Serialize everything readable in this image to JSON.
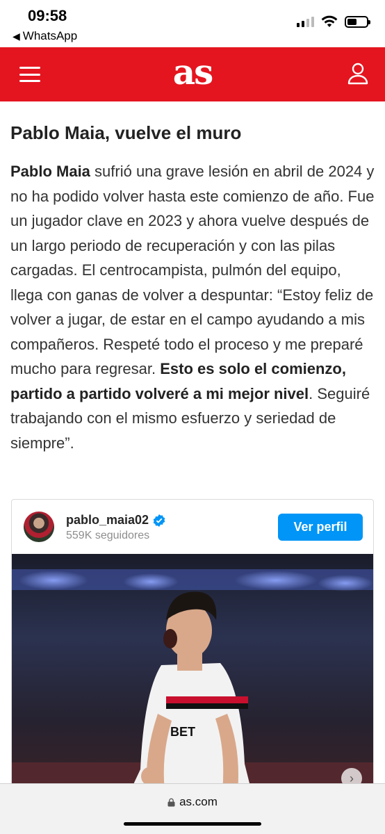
{
  "status_bar": {
    "time": "09:58",
    "back_app": "WhatsApp"
  },
  "header": {
    "logo": "as",
    "brand_color": "#e4151f"
  },
  "article": {
    "title": "Pablo Maia, vuelve el muro",
    "body": {
      "s1_bold": "Pablo Maia",
      "s2": " sufrió una grave lesión en abril de 2024 y no ha podido volver hasta este comienzo de año. Fue un jugador clave en 2023 y ahora vuelve después de un largo periodo de recuperación y con las pilas cargadas. El centrocampista, pulmón del equipo, llega con ganas de volver a despuntar: “Estoy feliz de volver a jugar, de estar en el campo ayudando a mis compañeros. Respeté todo el proceso y me preparé mucho para regresar. ",
      "s3_bold": "Esto es solo el comienzo, partido a partido volveré a mi mejor nivel",
      "s4": ". Seguiré trabajando con el mismo esfuerzo y seriedad de siempre”."
    }
  },
  "instagram": {
    "username": "pablo_maia02",
    "followers": "559K seguidores",
    "follow_button": "Ver perfil",
    "photo_jersey_text": "BET",
    "button_color": "#0095f6"
  },
  "browser": {
    "url": "as.com"
  },
  "icons": {
    "menu": "hamburger-icon",
    "user": "user-icon",
    "verified": "verified-badge-icon",
    "lock": "lock-icon",
    "next": "chevron-right-icon"
  }
}
